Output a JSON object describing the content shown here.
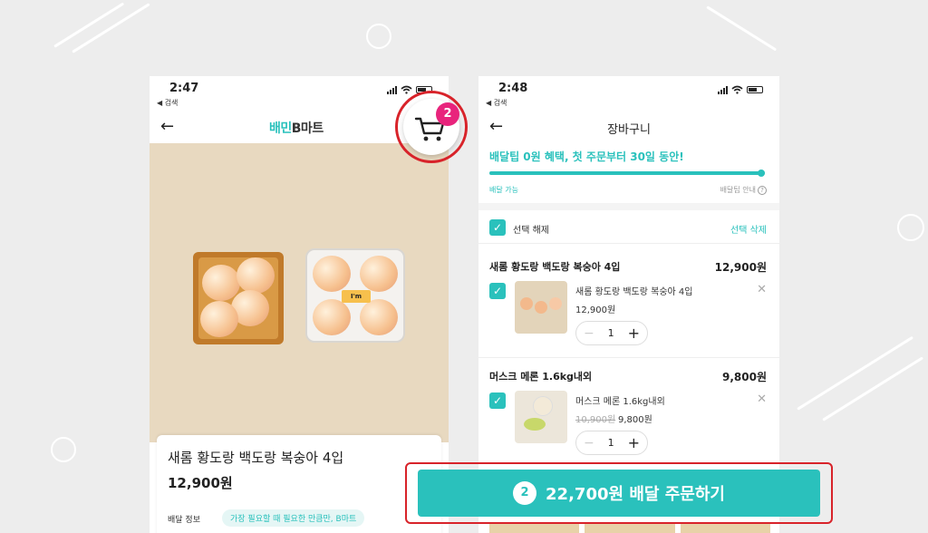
{
  "left_screen": {
    "status": {
      "time": "2:47",
      "back_app": "◀ 검색"
    },
    "brand": {
      "part1": "배민",
      "part2": "B마트"
    },
    "product": {
      "name": "새롬 황도랑 백도랑 복숭아 4입",
      "price": "12,900원",
      "delivery_label": "배달 정보",
      "delivery_info": "가장 필요할 때 필요한 만큼만, B마트"
    },
    "pack_label": "I'm"
  },
  "cart_float": {
    "badge_count": "2"
  },
  "right_screen": {
    "status": {
      "time": "2:48",
      "back_app": "◀ 검색"
    },
    "title": "장바구니",
    "promo": "배달팁 0원 혜택, 첫 주문부터 30일 동안!",
    "progress": {
      "value": 1.0,
      "left_label": "배달 가능",
      "right_label": "배달팁 안내",
      "help_icon": "?"
    },
    "select_all": {
      "label": "선택 해제",
      "delete_label": "선택 삭제"
    },
    "items": [
      {
        "group_title": "새롬 황도랑 백도랑 복숭아 4입",
        "group_price": "12,900원",
        "name": "새롬 황도랑 백도랑 복숭아 4입",
        "price": "12,900원",
        "quantity": "1"
      },
      {
        "group_title": "머스크 메론 1.6kg내외",
        "group_price": "9,800원",
        "name": "머스크 메론 1.6kg내외",
        "original_price": "10,900원",
        "price": "9,800원",
        "quantity": "1"
      }
    ]
  },
  "order_button": {
    "count": "2",
    "label": "22,700원 배달 주문하기"
  },
  "colors": {
    "accent": "#2ac1bc",
    "badge": "#e8247c",
    "highlight": "#d8232a"
  }
}
